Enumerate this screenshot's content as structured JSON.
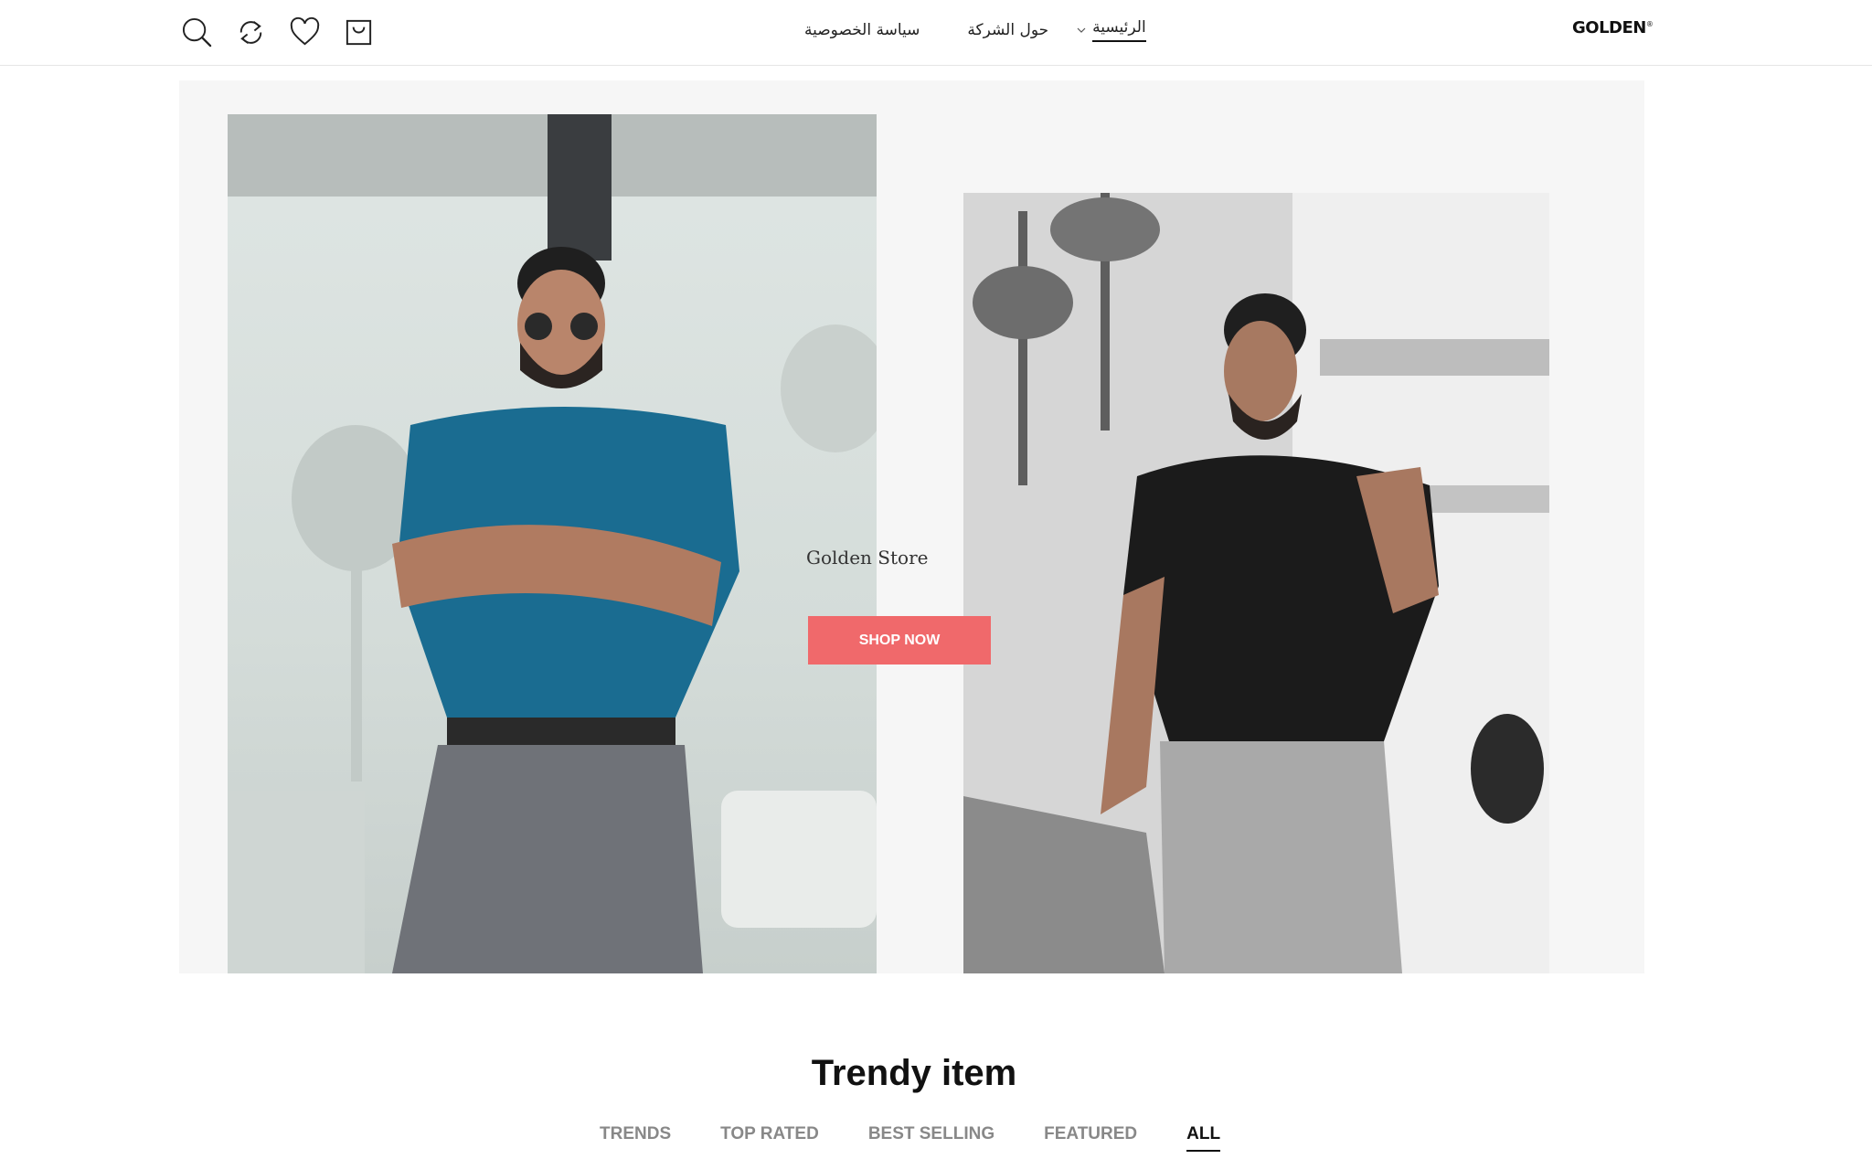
{
  "header": {
    "icons": [
      "search-icon",
      "compare-icon",
      "wishlist-icon",
      "cart-icon"
    ],
    "nav": {
      "privacy": "سياسة الخصوصية",
      "about": "حول الشركة",
      "home": "الرئيسية"
    },
    "logo": "GOLDEN",
    "logo_mark": "®"
  },
  "hero": {
    "store_name": "Golden Store",
    "cta": "SHOP NOW",
    "accent_color": "#f0696b"
  },
  "trendy": {
    "title": "Trendy item",
    "tabs": [
      "TRENDS",
      "TOP RATED",
      "BEST SELLING",
      "FEATURED",
      "ALL"
    ],
    "active_tab": "ALL"
  }
}
